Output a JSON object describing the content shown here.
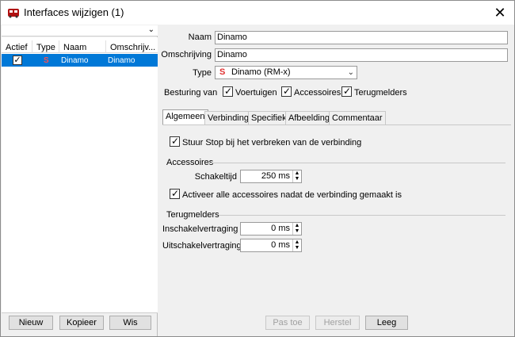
{
  "window": {
    "title": "Interfaces wijzigen (1)",
    "close_glyph": "✕"
  },
  "list": {
    "filter_glyph": "⌄",
    "columns": [
      "Actief",
      "Type",
      "Naam",
      "Omschrijv..."
    ],
    "rows": [
      {
        "active": true,
        "type": "S",
        "name": "Dinamo",
        "description": "Dinamo"
      }
    ],
    "buttons": {
      "new": "Nieuw",
      "copy": "Kopieer",
      "delete": "Wis"
    }
  },
  "form": {
    "name_label": "Naam",
    "name_value": "Dinamo",
    "description_label": "Omschrijving",
    "description_value": "Dinamo",
    "type_label": "Type",
    "type_icon": "S",
    "type_value": "Dinamo (RM-x)",
    "control_label": "Besturing van",
    "control_options": [
      "Voertuigen",
      "Accessoires",
      "Terugmelders"
    ]
  },
  "tabs": [
    "Algemeen",
    "Verbinding",
    "Specifiek",
    "Afbeelding",
    "Commentaar"
  ],
  "general": {
    "stop_on_disconnect": "Stuur Stop bij het verbreken van de verbinding",
    "accessories_group": "Accessoires",
    "switch_time_label": "Schakeltijd",
    "switch_time_value": "250 ms",
    "activate_all": "Activeer alle accessoires nadat de verbinding gemaakt is",
    "feedback_group": "Terugmelders",
    "on_delay_label": "Inschakelvertraging",
    "on_delay_value": "0 ms",
    "off_delay_label": "Uitschakelvertraging",
    "off_delay_value": "0 ms"
  },
  "actions": {
    "apply": "Pas toe",
    "restore": "Herstel",
    "empty": "Leeg"
  },
  "colors": {
    "selection": "#0078d7",
    "type_icon": "#e03030"
  }
}
